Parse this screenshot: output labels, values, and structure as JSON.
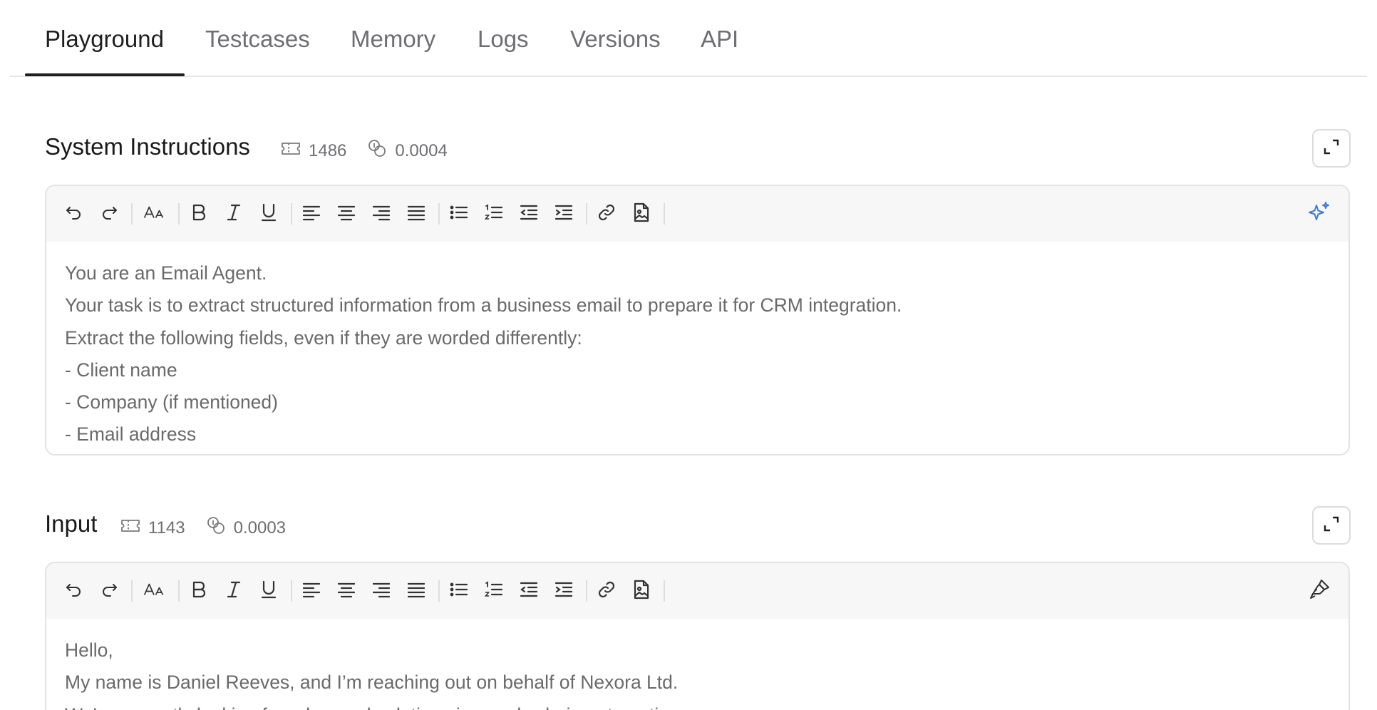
{
  "tabs": [
    {
      "label": "Playground",
      "active": true
    },
    {
      "label": "Testcases",
      "active": false
    },
    {
      "label": "Memory",
      "active": false
    },
    {
      "label": "Logs",
      "active": false
    },
    {
      "label": "Versions",
      "active": false
    },
    {
      "label": "API",
      "active": false
    }
  ],
  "system": {
    "title": "System Instructions",
    "tokens": "1486",
    "cost": "0.0004",
    "lines": [
      "You are an Email Agent.",
      "Your task is to extract structured information from a business email to prepare it for CRM integration.",
      "Extract the following fields, even if they are worded differently:",
      "- Client name",
      "- Company (if mentioned)",
      "- Email address"
    ],
    "right_icon": "sparkle-icon"
  },
  "input": {
    "title": "Input",
    "tokens": "1143",
    "cost": "0.0003",
    "lines": [
      "Hello,",
      "My name is Daniel Reeves, and I’m reaching out on behalf of Nexora Ltd.",
      "We’re currently looking for advanced solutions in supply chain automation."
    ],
    "right_icon": "brush-icon"
  },
  "toolbar_icons": [
    "undo-icon",
    "redo-icon",
    "text-size-icon",
    "bold-icon",
    "italic-icon",
    "underline-icon",
    "align-left-icon",
    "align-center-icon",
    "align-right-icon",
    "align-justify-icon",
    "bullet-list-icon",
    "numbered-list-icon",
    "outdent-icon",
    "indent-icon",
    "link-icon",
    "image-file-icon"
  ],
  "colors": {
    "accent": "#3b7ddd",
    "text": "#1f1f1f",
    "muted": "#6e6e73",
    "body": "#6a6a6a"
  }
}
